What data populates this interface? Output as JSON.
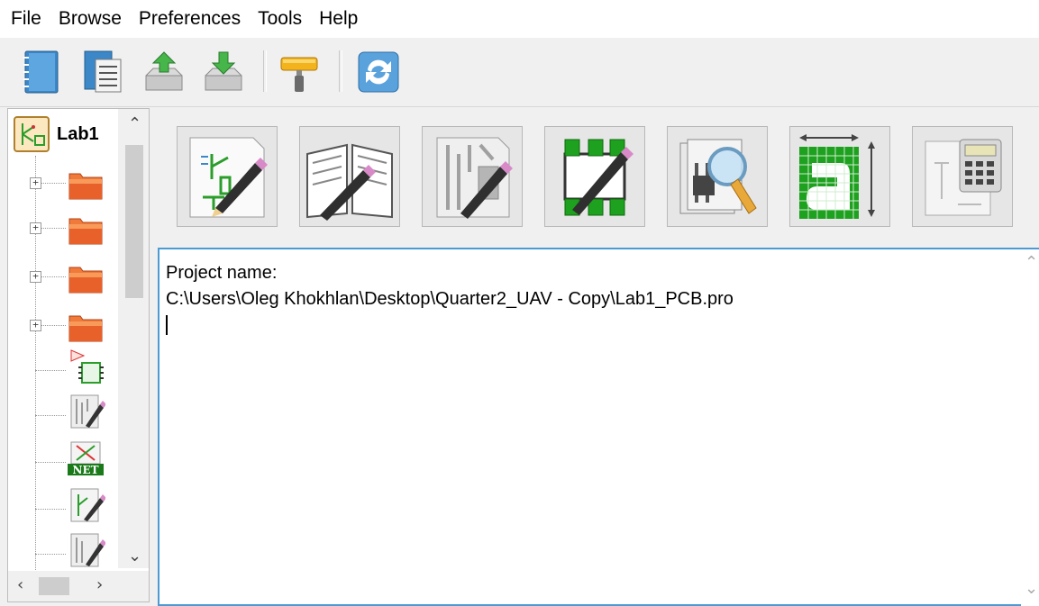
{
  "menubar": {
    "items": [
      "File",
      "Browse",
      "Preferences",
      "Tools",
      "Help"
    ]
  },
  "toolbar": {
    "icons": [
      "new-project-icon",
      "open-project-icon",
      "archive-upload-icon",
      "archive-download-icon",
      "paint-roller-icon",
      "refresh-icon"
    ]
  },
  "tree": {
    "root_label": "Lab1",
    "nodes": [
      {
        "icon": "folder-icon",
        "expander": "+"
      },
      {
        "icon": "folder-icon",
        "expander": "+"
      },
      {
        "icon": "folder-icon",
        "expander": "+"
      },
      {
        "icon": "folder-icon",
        "expander": "+"
      },
      {
        "icon": "schematic-component-icon"
      },
      {
        "icon": "pcb-edit-icon"
      },
      {
        "icon": "netlist-icon",
        "badge": "NET"
      },
      {
        "icon": "schematic-edit-icon"
      },
      {
        "icon": "pcb-edit-icon"
      }
    ]
  },
  "tools": {
    "buttons": [
      "schematic-editor-icon",
      "symbol-library-editor-icon",
      "pcb-layout-editor-icon",
      "footprint-editor-icon",
      "gerber-viewer-icon",
      "bitmap-to-component-icon",
      "pcb-calculator-icon"
    ]
  },
  "message": {
    "line1": "Project name:",
    "line2": "C:\\Users\\Oleg Khokhlan\\Desktop\\Quarter2_UAV - Copy\\Lab1_PCB.pro"
  },
  "colors": {
    "focus_border": "#4a9bd4",
    "folder": "#e8602a",
    "green": "#2a9d2a"
  }
}
